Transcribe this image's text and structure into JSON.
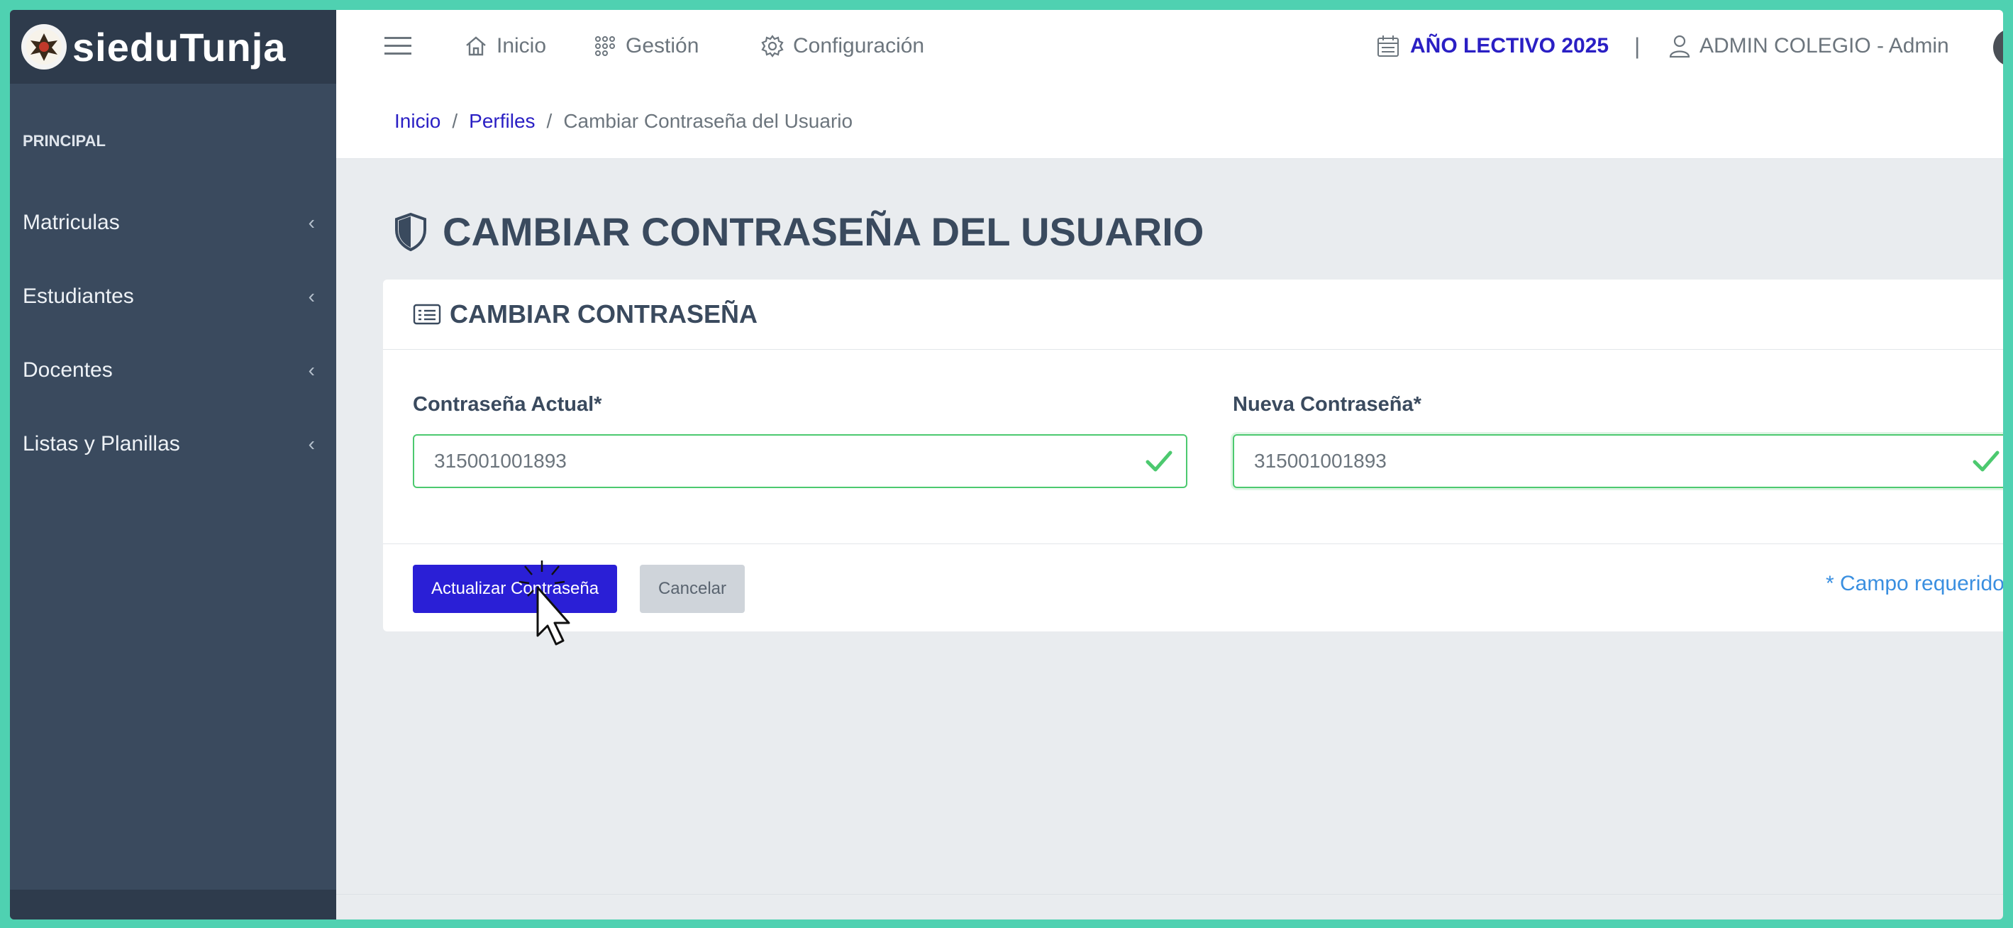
{
  "app": {
    "brand": "sieduTunja"
  },
  "sidebar": {
    "section_label": "PRINCIPAL",
    "items": [
      {
        "label": "Matriculas",
        "chevron": "‹"
      },
      {
        "label": "Estudiantes",
        "chevron": "‹"
      },
      {
        "label": "Docentes",
        "chevron": "‹"
      },
      {
        "label": "Listas y Planillas",
        "chevron": "‹"
      }
    ]
  },
  "topbar": {
    "links": [
      {
        "label": "Inicio",
        "icon": "home-icon"
      },
      {
        "label": "Gestión",
        "icon": "grid-icon"
      },
      {
        "label": "Configuración",
        "icon": "gear-icon"
      }
    ],
    "year_label": "AÑO LECTIVO 2025",
    "separator": "|",
    "user_label": "ADMIN COLEGIO - Admin"
  },
  "breadcrumb": {
    "items": [
      "Inicio",
      "Perfiles"
    ],
    "separator": "/",
    "current": "Cambiar Contraseña del Usuario"
  },
  "page": {
    "title": "CAMBIAR CONTRASEÑA DEL USUARIO"
  },
  "form": {
    "header": "CAMBIAR CONTRASEÑA",
    "current_password": {
      "label": "Contraseña Actual*",
      "value": "315001001893"
    },
    "new_password": {
      "label": "Nueva Contraseña*",
      "value": "315001001893"
    },
    "submit_label": "Actualizar Contraseña",
    "cancel_label": "Cancelar",
    "required_note": "* Campo requerido"
  },
  "colors": {
    "accent": "#2a1fd6",
    "sidebar": "#3a4a5e",
    "valid": "#4cc96f",
    "frame": "#4fd1b1"
  }
}
